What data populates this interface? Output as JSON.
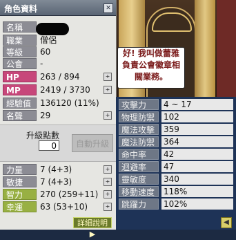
{
  "window": {
    "title": "角色資料"
  },
  "stats": [
    {
      "label": "名稱",
      "value": "",
      "style": "grey",
      "button": false
    },
    {
      "label": "職業",
      "value": "僧侶",
      "style": "grey",
      "button": false
    },
    {
      "label": "等級",
      "value": "60",
      "style": "grey",
      "button": false
    },
    {
      "label": "公會",
      "value": "-",
      "style": "grey",
      "button": false
    },
    {
      "label": "HP",
      "value": "263 / 894",
      "style": "pink",
      "button": true
    },
    {
      "label": "MP",
      "value": "2419 / 3730",
      "style": "pink",
      "button": true
    },
    {
      "label": "經驗值",
      "value": "136120 (11%)",
      "style": "grey",
      "button": false
    },
    {
      "label": "名聲",
      "value": "29",
      "style": "grey",
      "button": true
    }
  ],
  "promotion": {
    "label": "升級點數",
    "points": "0",
    "auto_button": "自動升級"
  },
  "attributes": [
    {
      "label": "力量",
      "value": "7 (4+3)",
      "style": "grey"
    },
    {
      "label": "敏捷",
      "value": "7 (4+3)",
      "style": "grey"
    },
    {
      "label": "智力",
      "value": "270 (259+11)",
      "style": "green"
    },
    {
      "label": "幸運",
      "value": "63 (53+10)",
      "style": "green"
    }
  ],
  "detail_button": "詳細說明 ▶",
  "detail": [
    {
      "label": "攻擊力",
      "value": "4 ~ 17"
    },
    {
      "label": "物理防禦力",
      "value": "102"
    },
    {
      "label": "魔法攻擊力",
      "value": "359"
    },
    {
      "label": "魔法防禦力",
      "value": "364"
    },
    {
      "label": "命中率",
      "value": "42"
    },
    {
      "label": "迴避率",
      "value": "47"
    },
    {
      "label": "靈敏度",
      "value": "340"
    },
    {
      "label": "移動速度",
      "value": "118%"
    },
    {
      "label": "跳躍力",
      "value": "102%"
    }
  ],
  "npc_speech": [
    "好! 我叫做蕾雅",
    "負責公會徽章相",
    "關業務。"
  ],
  "icons": {
    "close": "close-icon",
    "plus": "plus-icon",
    "back": "back-arrow-icon"
  }
}
